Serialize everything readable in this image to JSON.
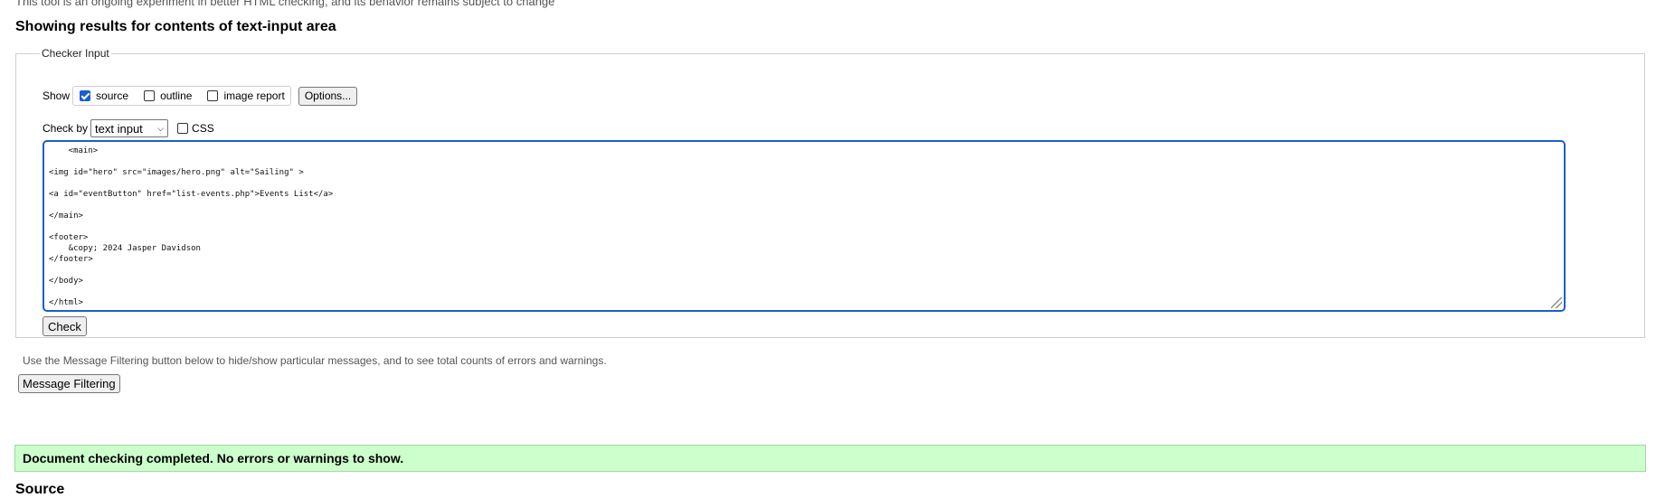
{
  "intro_text": "This tool is an ongoing experiment in better HTML checking, and its behavior remains subject to change",
  "results_title": "Showing results for contents of text-input area",
  "checker": {
    "legend": "Checker Input",
    "show_label": "Show",
    "options": [
      {
        "label": "source",
        "checked": true
      },
      {
        "label": "outline",
        "checked": false
      },
      {
        "label": "image report",
        "checked": false
      }
    ],
    "options_button": "Options...",
    "check_by_label": "Check by",
    "check_by_value": "text input",
    "css_label": "CSS",
    "css_checked": false,
    "source_text": "    <main>\n\n<img id=\"hero\" src=\"images/hero.png\" alt=\"Sailing\" >\n\n<a id=\"eventButton\" href=\"list-events.php\">Events List</a>\n\n</main>\n\n<footer>\n    &copy; 2024 Jasper Davidson\n</footer>\n\n</body>\n\n</html>",
    "check_button": "Check"
  },
  "filter_note": "Use the Message Filtering button below to hide/show particular messages, and to see total counts of errors and warnings.",
  "filter_button": "Message Filtering",
  "status_message": "Document checking completed. No errors or warnings to show.",
  "colors": {
    "focus_blue": "#1a5fd0",
    "success_bg": "#ccffcc"
  },
  "source_heading": "Source"
}
